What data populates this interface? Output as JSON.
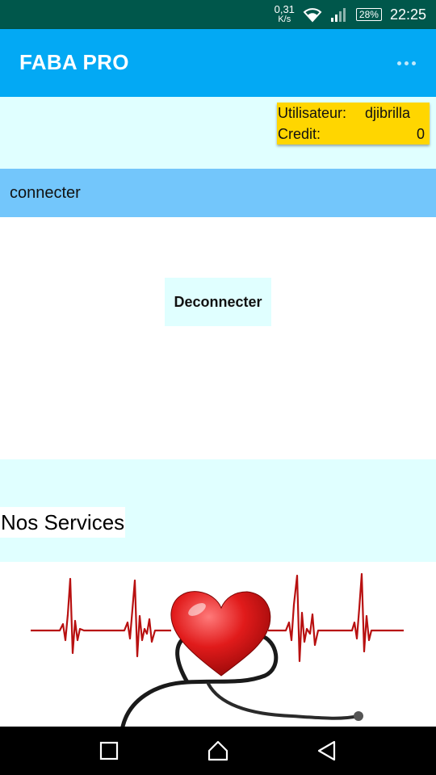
{
  "status_bar": {
    "net_speed_value": "0,31",
    "net_speed_unit": "K/s",
    "battery": "28%",
    "time": "22:25"
  },
  "app_bar": {
    "title": "FABA PRO",
    "overflow_icon": "more-dots-icon"
  },
  "user_panel": {
    "user_label": "Utilisateur:",
    "user_value": "djibrilla",
    "credit_label": "Credit:",
    "credit_value": "0"
  },
  "connection": {
    "status_label": "connecter"
  },
  "actions": {
    "logout_label": "Deconnecter"
  },
  "services": {
    "title": "Nos Services",
    "banner_image": "heartbeat-stethoscope-heart"
  },
  "nav_bar": {
    "back_icon": "back-triangle-icon",
    "home_icon": "home-icon",
    "recent_icon": "recent-apps-icon"
  },
  "colors": {
    "status_bar": "#00574b",
    "app_bar": "#03a9f4",
    "info_background": "#e0ffff",
    "user_card": "#ffd600",
    "connect_bar": "#73c6fb",
    "heart": "#e11b1b"
  }
}
